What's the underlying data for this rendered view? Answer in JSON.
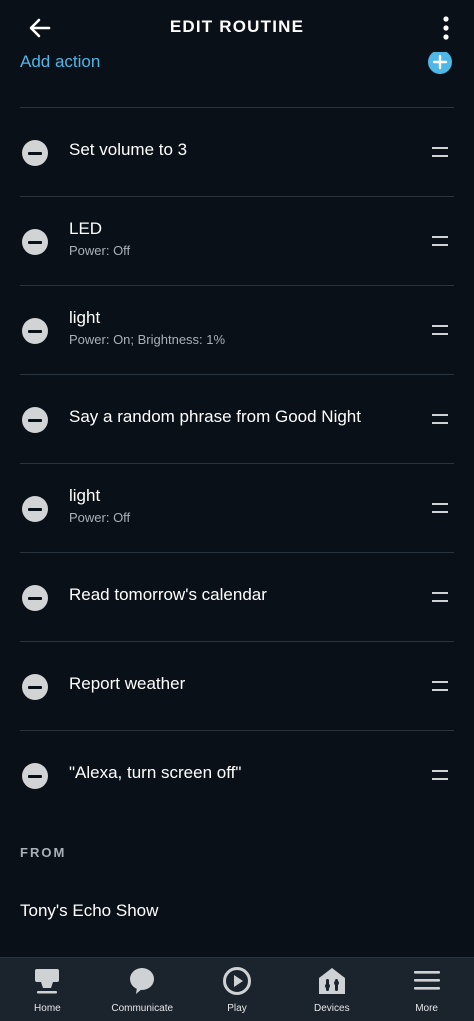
{
  "header": {
    "title": "EDIT ROUTINE",
    "back_icon": "arrow-left-icon",
    "menu_icon": "kebab-menu-icon"
  },
  "add_action": {
    "label": "Add action",
    "icon": "plus-circle-icon",
    "accent_color": "#4fb7e6"
  },
  "actions": [
    {
      "title": "Set volume to 3",
      "subtitle": ""
    },
    {
      "title": "LED",
      "subtitle": "Power: Off"
    },
    {
      "title": "light",
      "subtitle": "Power: On; Brightness: 1%"
    },
    {
      "title": "Say a random phrase from Good Night",
      "subtitle": ""
    },
    {
      "title": "light",
      "subtitle": "Power: Off"
    },
    {
      "title": "Read tomorrow's calendar",
      "subtitle": ""
    },
    {
      "title": "Report weather",
      "subtitle": ""
    },
    {
      "title": "\"Alexa, turn screen off\"",
      "subtitle": ""
    }
  ],
  "from_section": {
    "label": "FROM",
    "device": "Tony's Echo Show"
  },
  "nav": {
    "items": [
      {
        "label": "Home",
        "icon": "home-icon"
      },
      {
        "label": "Communicate",
        "icon": "speech-bubble-icon"
      },
      {
        "label": "Play",
        "icon": "play-icon"
      },
      {
        "label": "Devices",
        "icon": "devices-icon"
      },
      {
        "label": "More",
        "icon": "hamburger-menu-icon"
      }
    ]
  }
}
